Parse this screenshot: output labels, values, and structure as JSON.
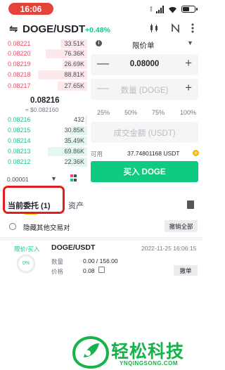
{
  "status_bar": {
    "time": "16:06"
  },
  "header": {
    "swap_icon": "⇋",
    "pair": "DOGE/USDT",
    "change": "+0.48%",
    "icons": [
      "candlestick-icon",
      "indicator-icon",
      "more-icon"
    ]
  },
  "order_book": {
    "asks": [
      {
        "price": "0.08221",
        "qty": "33.51K",
        "depth": 0.55
      },
      {
        "price": "0.08220",
        "qty": "76.36K",
        "depth": 0.85
      },
      {
        "price": "0.08219",
        "qty": "26.69K",
        "depth": 0.5
      },
      {
        "price": "0.08218",
        "qty": "88.81K",
        "depth": 1.0
      },
      {
        "price": "0.08217",
        "qty": "27.65K",
        "depth": 0.6
      }
    ],
    "mid_price": "0.08216",
    "mid_usd": "≈ $0.082160",
    "bids": [
      {
        "price": "0.08216",
        "qty": "432",
        "depth": 0.05
      },
      {
        "price": "0.08215",
        "qty": "30.85K",
        "depth": 0.35
      },
      {
        "price": "0.08214",
        "qty": "35.49K",
        "depth": 0.45
      },
      {
        "price": "0.08213",
        "qty": "69.86K",
        "depth": 0.8
      },
      {
        "price": "0.08212",
        "qty": "22.36K",
        "depth": 0.4
      }
    ],
    "depth_precision": "0.00001"
  },
  "trade_form": {
    "order_type": "限价单",
    "price_value": "0.08000",
    "amount_placeholder": "数量 (DOGE)",
    "percentages": [
      "25%",
      "50%",
      "75%",
      "100%"
    ],
    "total_placeholder": "成交金额 (USDT)",
    "available_label": "可用",
    "available_value": "37.74801168 USDT",
    "buy_label": "买入 DOGE",
    "minus": "—",
    "plus": "+"
  },
  "tabs": {
    "open_orders": "当前委托 (1)",
    "assets": "资产"
  },
  "filters": {
    "hide_other_pairs": "隐藏其他交易对",
    "cancel_all": "撤销全部"
  },
  "open_order": {
    "type": "限价/买入",
    "pair": "DOGE/USDT",
    "date": "2022-11-25 16:06:15",
    "fill_percent": 0,
    "fill_label": "0%",
    "qty_label": "数量",
    "qty_value": "0.00 / 156.00",
    "price_label": "价格",
    "price_value": "0.08",
    "cancel_label": "撤单"
  },
  "watermark": {
    "title": "轻松科技",
    "subtitle": "YNQINGSONG.COM"
  },
  "colors": {
    "buy": "#0ecb81",
    "sell": "#f6465d",
    "accent": "#f0b90b",
    "highlight": "#e02020"
  }
}
